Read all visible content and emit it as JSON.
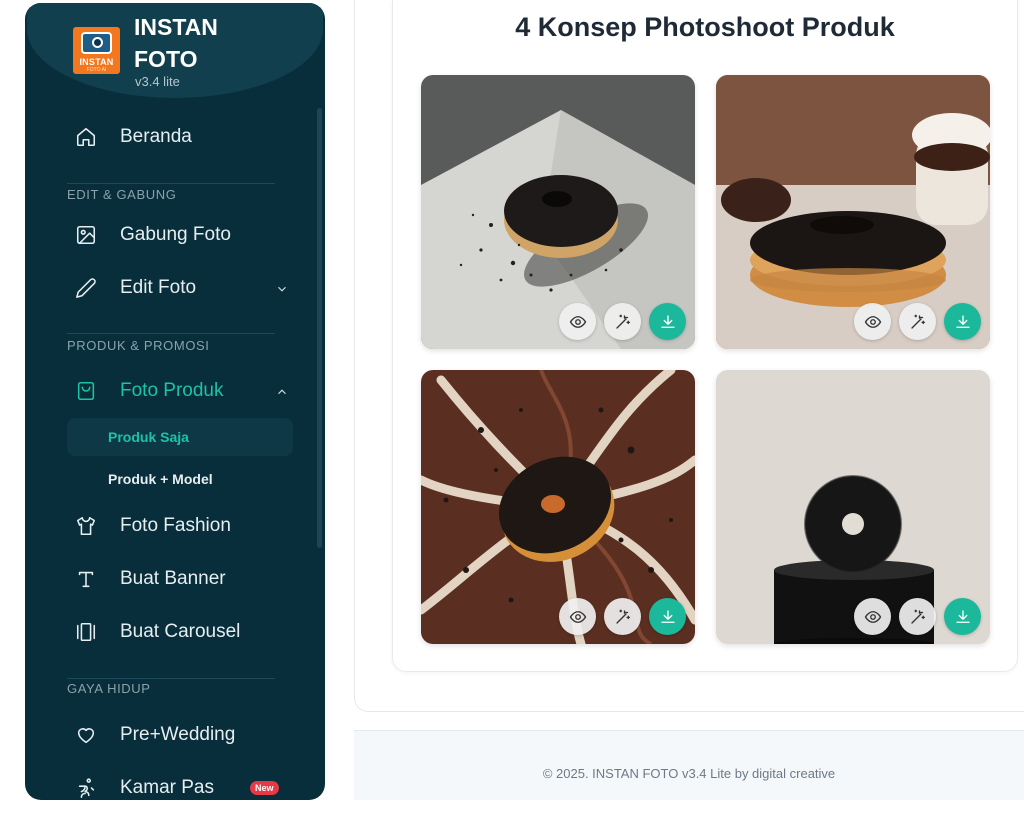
{
  "brand": {
    "logo_text": "INSTAN",
    "logo_sub": "FOTO AI",
    "title": "INSTAN FOTO",
    "version": "v3.4 lite"
  },
  "sidebar": {
    "home": "Beranda",
    "section_edit": "EDIT & GABUNG",
    "merge_photo": "Gabung Foto",
    "edit_photo": "Edit Foto",
    "section_product": "PRODUK & PROMOSI",
    "product_photo": "Foto Produk",
    "sub_product_only": "Produk Saja",
    "sub_product_model": "Produk + Model",
    "fashion_photo": "Foto Fashion",
    "make_banner": "Buat Banner",
    "make_carousel": "Buat Carousel",
    "section_lifestyle": "GAYA HIDUP",
    "prewedding": "Pre+Wedding",
    "fitting_room": "Kamar Pas",
    "new_badge": "New"
  },
  "main": {
    "heading": "4 Konsep Photoshoot Produk",
    "photos": [
      {
        "name": "donut-grey-studio"
      },
      {
        "name": "donut-marble-table"
      },
      {
        "name": "donut-chocolate-splash"
      },
      {
        "name": "donut-black-pedestal"
      }
    ]
  },
  "footer": {
    "text": "© 2025. INSTAN FOTO v3.4 Lite by digital creative"
  },
  "colors": {
    "sidebar_bg": "#082d3b",
    "accent": "#1cc3a4",
    "download_btn": "#1cb89b"
  }
}
